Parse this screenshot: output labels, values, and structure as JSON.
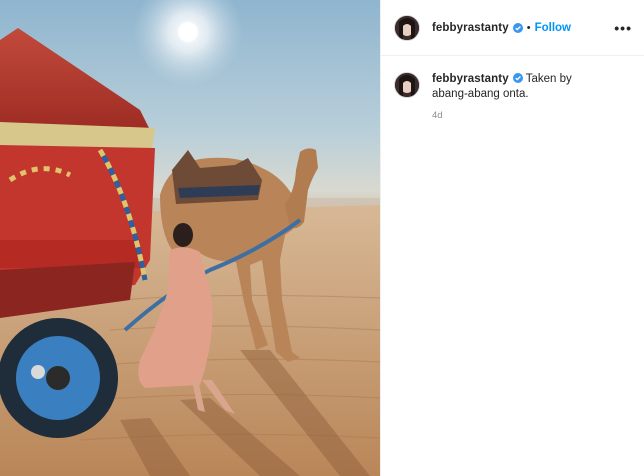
{
  "post": {
    "username": "febbyrastanty",
    "follow_label": "Follow",
    "separator": "•",
    "more_label": "•••",
    "caption": "Taken by abang-abang onta.",
    "timestamp": "4d"
  },
  "icons": {
    "verified": "verified-badge-icon",
    "more": "more-options-icon"
  },
  "colors": {
    "accent": "#0095f6",
    "verified": "#3897f0",
    "muted": "#8e8e8e"
  }
}
